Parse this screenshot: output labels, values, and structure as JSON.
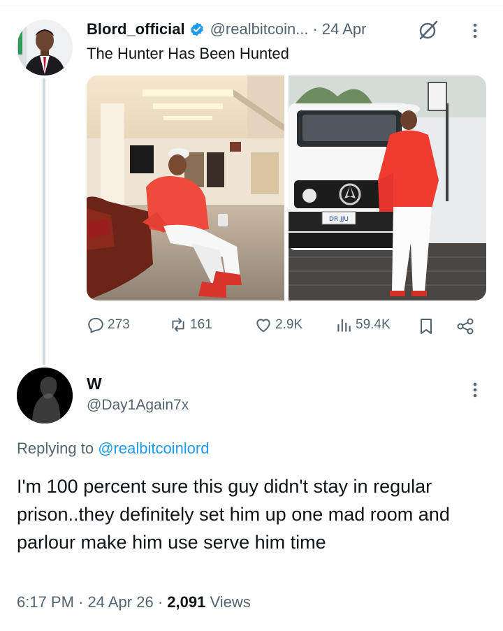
{
  "quoted_tweet": {
    "display_name": "Blord_official",
    "handle": "@realbitcoin...",
    "separator": "·",
    "date": "24 Apr",
    "text": "The Hunter Has Been Hunted",
    "icons": {
      "verified": "verified-badge-icon",
      "grok": "grok-icon",
      "more": "more-options-icon"
    },
    "stats": {
      "replies": "273",
      "reposts": "161",
      "likes": "2.9K",
      "views": "59.4K"
    },
    "media_plate": "DR JJU"
  },
  "reply": {
    "display_name": "W",
    "handle": "@Day1Again7x",
    "replying_prefix": "Replying to ",
    "replying_to": "@realbitcoinlord",
    "text": "I'm 100 percent sure this guy didn't stay in regular prison..they definitely set him up one mad room and parlour make him use serve him time",
    "time": "6:17 PM",
    "date": "24 Apr 26",
    "views_count": "2,091",
    "views_label": "Views",
    "separator": "·"
  },
  "colors": {
    "accent": "#1d9bf0",
    "secondary_text": "#536471",
    "primary_text": "#0f1419",
    "thread_line": "#cfd9de"
  }
}
